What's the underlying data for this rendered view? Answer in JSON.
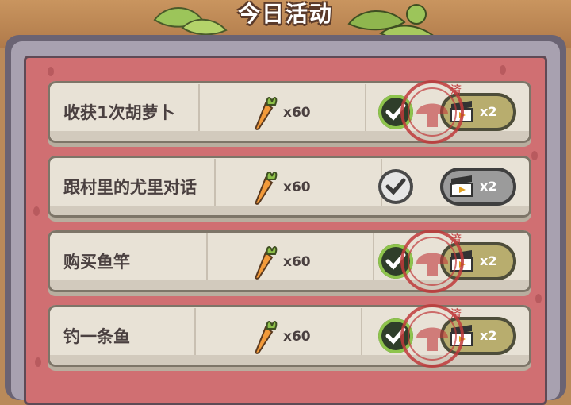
{
  "header": {
    "title": "今日活动"
  },
  "tasks": [
    {
      "label": "收获1次胡萝卜",
      "reward": "x60",
      "reward_icon": "carrot-icon",
      "completed": true,
      "stamped": true,
      "double_label": "x2",
      "stamp_char": "済"
    },
    {
      "label": "跟村里的尤里对话",
      "reward": "x60",
      "reward_icon": "carrot-icon",
      "completed": false,
      "stamped": false,
      "double_label": "x2",
      "stamp_char": ""
    },
    {
      "label": "购买鱼竿",
      "reward": "x60",
      "reward_icon": "carrot-icon",
      "completed": true,
      "stamped": true,
      "double_label": "x2",
      "stamp_char": "済"
    },
    {
      "label": "钓一条鱼",
      "reward": "x60",
      "reward_icon": "carrot-icon",
      "completed": true,
      "stamped": true,
      "double_label": "x2",
      "stamp_char": "済"
    }
  ],
  "colors": {
    "panel_red": "#d06f72",
    "check_green": "#8ec44c",
    "button_olive": "#b8ad6e",
    "stamp_red": "#c0393b"
  }
}
